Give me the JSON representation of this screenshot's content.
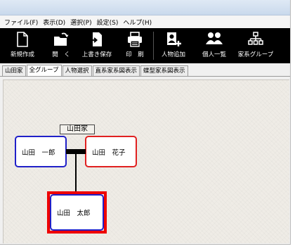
{
  "menu": {
    "items": [
      "ファイル(F)",
      "表示(D)",
      "選択(P)",
      "設定(S)",
      "ヘルプ(H)"
    ]
  },
  "toolbar": {
    "new": "新規作成",
    "open": "開　く",
    "overwrite": "上書き保存",
    "print": "印　刷",
    "add_person": "人物追加",
    "person_list": "個人一覧",
    "family_group": "家系グループ"
  },
  "tabs": [
    "山田家",
    "全グループ",
    "人物選択",
    "直系家系図表示",
    "蝶型家系図表示"
  ],
  "tree": {
    "family_name": "山田家",
    "husband": "山田　一郎",
    "wife": "山田　花子",
    "child": "山田　太郎"
  },
  "colors": {
    "male_border": "#2020c8",
    "female_border": "#e02020",
    "selection": "#ee0000"
  }
}
